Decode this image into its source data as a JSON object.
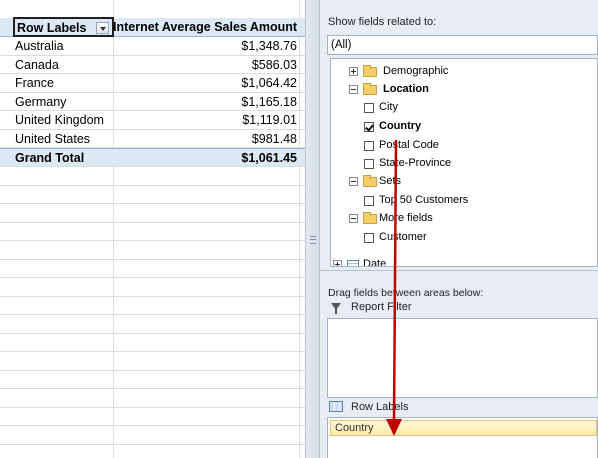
{
  "pivot": {
    "header": {
      "row_labels": "Row Labels",
      "measure": "Internet Average Sales Amount"
    },
    "rows": [
      {
        "label": "Australia",
        "value": "$1,348.76"
      },
      {
        "label": "Canada",
        "value": "$586.03"
      },
      {
        "label": "France",
        "value": "$1,064.42"
      },
      {
        "label": "Germany",
        "value": "$1,165.18"
      },
      {
        "label": "United Kingdom",
        "value": "$1,119.01"
      },
      {
        "label": "United States",
        "value": "$981.48"
      }
    ],
    "total": {
      "label": "Grand Total",
      "value": "$1,061.45"
    }
  },
  "field_list": {
    "show_fields_label": "Show fields related to:",
    "related_select_value": "(All)",
    "tree": {
      "demographic": "Demographic",
      "location": "Location",
      "city": "City",
      "country": "Country",
      "postal_code": "Postal Code",
      "state_province": "State-Province",
      "sets": "Sets",
      "top_50": "Top 50 Customers",
      "more_fields": "More fields",
      "customer": "Customer",
      "date": "Date"
    },
    "checked": {
      "country": true,
      "city": false,
      "postal_code": false,
      "state_province": false,
      "top_50": false,
      "customer": false
    }
  },
  "areas": {
    "drag_label": "Drag fields between areas below:",
    "report_filter": "Report Filter",
    "row_labels": "Row Labels",
    "row_field": "Country"
  },
  "colors": {
    "header_fill": "#dde8f5",
    "drag_arrow": "#c00000",
    "chip_fill": "#fde9a6"
  }
}
